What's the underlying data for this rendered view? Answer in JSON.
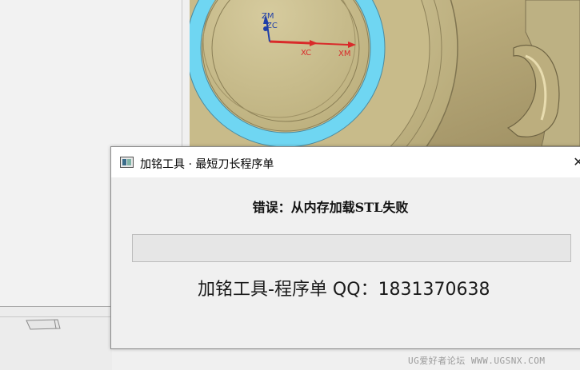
{
  "viewport": {
    "axis_labels": {
      "zm": "ZM",
      "zc": "ZC",
      "xc": "XC",
      "xm": "XM"
    },
    "colors": {
      "part": "#c9bd8f",
      "part_dark": "#8f8155",
      "highlight_ring": "#6fd6f2",
      "axis_x": "#d92a2a",
      "axis_z": "#1f3fa8"
    }
  },
  "dialog": {
    "title": "加铭工具 · 最短刀长程序单",
    "close_glyph": "✕",
    "error_message": "错误：从内存加载STL失败",
    "progress_percent": 0,
    "footer_text": "加铭工具-程序单 QQ：1831370638"
  },
  "watermark": {
    "text": "UG爱好者论坛 WWW.UGSNX.COM"
  }
}
